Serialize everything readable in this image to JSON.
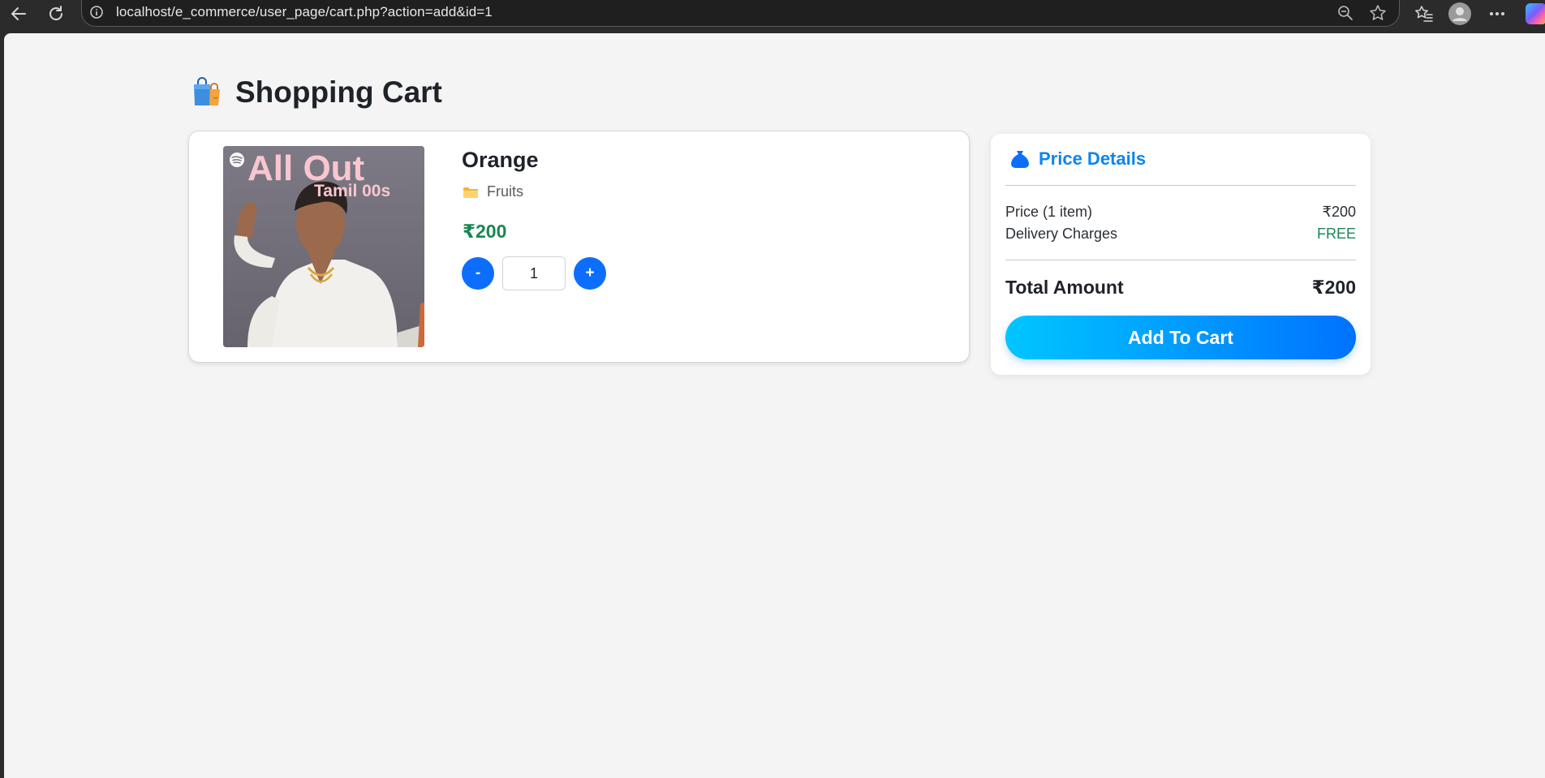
{
  "browser": {
    "url": "localhost/e_commerce/user_page/cart.php?action=add&id=1"
  },
  "page": {
    "title": "Shopping Cart",
    "title_icon": "shopping-bags-icon"
  },
  "cart_item": {
    "name": "Orange",
    "category": "Fruits",
    "category_icon": "folder-icon",
    "price": "₹200",
    "quantity": "1",
    "decrement_label": "-",
    "increment_label": "+",
    "image_text": {
      "line1": "All Out",
      "line2": "Tamil 00s"
    }
  },
  "price_details": {
    "heading": "Price Details",
    "heading_icon": "money-bag-icon",
    "price_label": "Price (1 item)",
    "price_value": "₹200",
    "delivery_label": "Delivery Charges",
    "delivery_value": "FREE",
    "total_label": "Total Amount",
    "total_value": "₹200",
    "cta_label": "Add To Cart"
  },
  "colors": {
    "accent": "#0d6efd",
    "price_green": "#198754",
    "heading_blue": "#0d84f0"
  }
}
